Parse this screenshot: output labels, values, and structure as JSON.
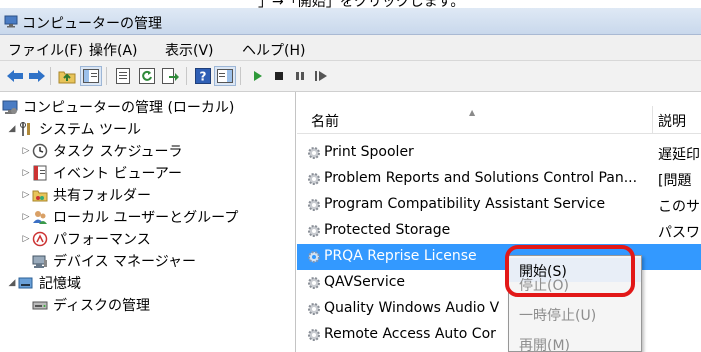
{
  "top_clip_text": "」→「開始」をクリックします。",
  "window": {
    "title": "コンピューターの管理"
  },
  "menu": [
    "ファイル(F)",
    "操作(A)",
    "表示(V)",
    "ヘルプ(H)"
  ],
  "toolbar": {
    "icons": [
      "back-arrow-icon",
      "forward-arrow-icon",
      "up-folder-icon",
      "show-tree-icon",
      "properties-icon",
      "refresh-icon",
      "export-list-icon",
      "help-icon",
      "action-pane-icon",
      "start-service-icon",
      "stop-service-icon",
      "pause-service-icon",
      "restart-service-icon"
    ]
  },
  "tree": [
    {
      "label": "コンピューターの管理 (ローカル)",
      "icon": "computer-management-icon"
    },
    {
      "label": "システム ツール",
      "icon": "tools-icon"
    },
    {
      "label": "タスク スケジューラ",
      "icon": "clock-icon"
    },
    {
      "label": "イベント ビューアー",
      "icon": "event-viewer-icon"
    },
    {
      "label": "共有フォルダー",
      "icon": "shared-folder-icon"
    },
    {
      "label": "ローカル ユーザーとグループ",
      "icon": "users-icon"
    },
    {
      "label": "パフォーマンス",
      "icon": "performance-icon"
    },
    {
      "label": "デバイス マネージャー",
      "icon": "device-manager-icon"
    },
    {
      "label": "記憶域",
      "icon": "storage-icon"
    },
    {
      "label": "ディスクの管理",
      "icon": "disk-icon"
    }
  ],
  "services": {
    "columns": [
      "名前",
      "説明"
    ],
    "rows": [
      {
        "name": "Print Spooler",
        "desc": "遅延印"
      },
      {
        "name": "Problem Reports and Solutions Control Pan...",
        "desc": "[問題"
      },
      {
        "name": "Program Compatibility Assistant Service",
        "desc": "このサ"
      },
      {
        "name": "Protected Storage",
        "desc": "パスワ"
      },
      {
        "name": "PRQA Reprise License",
        "desc": ""
      },
      {
        "name": "QAVService",
        "desc": ""
      },
      {
        "name": "Quality Windows Audio V",
        "desc": ""
      },
      {
        "name": "Remote Access Auto Cor",
        "desc": ""
      }
    ],
    "selected_row": "PRQA Reprise License"
  },
  "context_menu": {
    "items": [
      {
        "label": "開始(S)",
        "state": "highlighted"
      },
      {
        "label": "停止(O)",
        "state": "disabled"
      },
      {
        "label": "一時停止(U)",
        "state": "disabled"
      },
      {
        "label": "再開(M)",
        "state": "disabled"
      }
    ]
  },
  "colors": {
    "selection": "#3399ff",
    "callout": "#e21818",
    "title_gradient_top": "#dfe9f5"
  }
}
